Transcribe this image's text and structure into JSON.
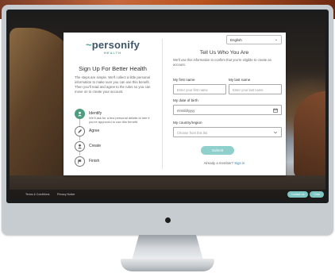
{
  "language_select": {
    "value": "English"
  },
  "brand": {
    "name": "personify",
    "sub": "HEALTH"
  },
  "left": {
    "title": "Sign Up For Better Health",
    "description": "The steps are simple. We'll collect a little personal information to make sure you can use this benefit. Then you'll read and agree to the rules so you can move on to create your account.",
    "steps": [
      {
        "label": "Identify",
        "note": "We'll ask for a few personal details to see if you're approved to use this benefit.",
        "icon": "person-icon",
        "active": true
      },
      {
        "label": "Agree",
        "note": "",
        "icon": "pencil-icon",
        "active": false
      },
      {
        "label": "Create",
        "note": "",
        "icon": "person-icon",
        "active": false
      },
      {
        "label": "Finish",
        "note": "",
        "icon": "flag-icon",
        "active": false
      }
    ]
  },
  "form": {
    "title": "Tell Us Who You Are",
    "description": "We'll use this information to confirm that you're eligible to create an account.",
    "first_name": {
      "label": "My first name",
      "placeholder": "Enter your first name"
    },
    "last_name": {
      "label": "My last name",
      "placeholder": "Enter your last name"
    },
    "dob": {
      "label": "My date of birth",
      "placeholder": "mm/dd/yyyy"
    },
    "country": {
      "label": "My country/region",
      "placeholder": "Choose from this list"
    },
    "submit_label": "Submit",
    "member_text": "Already a member?",
    "signin_label": "Sign in"
  },
  "footer": {
    "link1": "Terms & Conditions",
    "link2": "Privacy Notice",
    "pill1": "Contact Us",
    "pill2": "Chat"
  },
  "colors": {
    "accent": "#4f9d7f",
    "button": "#8fd0cd",
    "link": "#2f7fb5",
    "brand_text": "#3e5568"
  }
}
